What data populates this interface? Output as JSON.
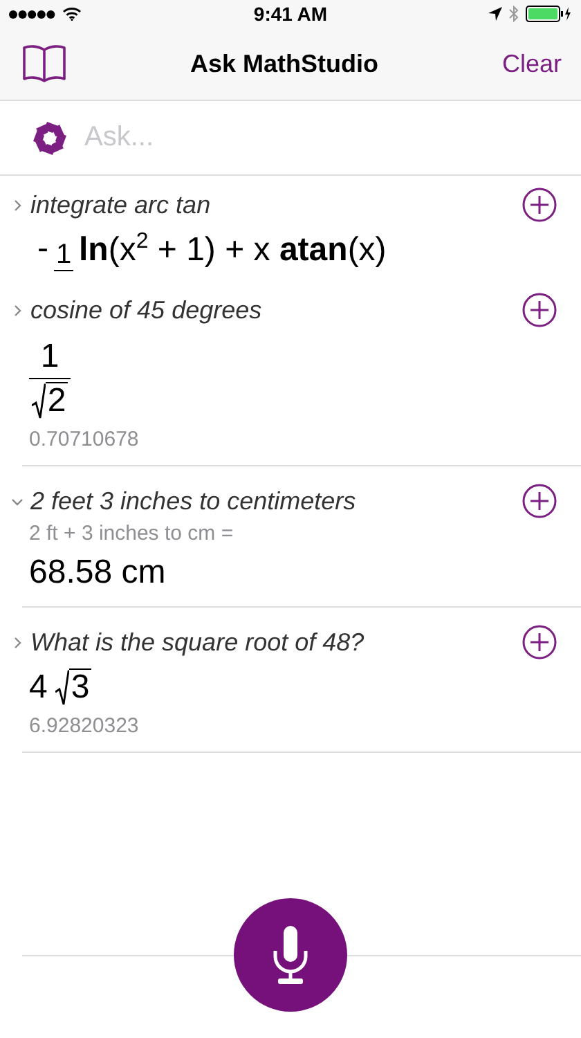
{
  "status_bar": {
    "time": "9:41 AM"
  },
  "nav": {
    "title": "Ask MathStudio",
    "right_action": "Clear"
  },
  "ask": {
    "placeholder": "Ask..."
  },
  "entries": [
    {
      "query": "integrate arc tan",
      "expanded": false,
      "result": {
        "kind": "clipped_formula",
        "sign": "-",
        "numerator": "1",
        "body": "**ln**(x$^{2}$ + 1) + x **atan**(x)"
      }
    },
    {
      "query": "cosine of 45 degrees",
      "expanded": false,
      "result": {
        "kind": "fraction_radical",
        "numerator": "1",
        "radicand": "2"
      },
      "decimal": "0.70710678"
    },
    {
      "query": "2 feet 3 inches to centimeters",
      "expanded": true,
      "echo": "2 ft + 3 inches to cm =",
      "result": {
        "kind": "text",
        "text": "68.58 cm"
      }
    },
    {
      "query": "What is the square root of 48?",
      "expanded": false,
      "result": {
        "kind": "radical",
        "coefficient": "4",
        "radicand": "3"
      },
      "decimal": "6.92820323"
    }
  ]
}
